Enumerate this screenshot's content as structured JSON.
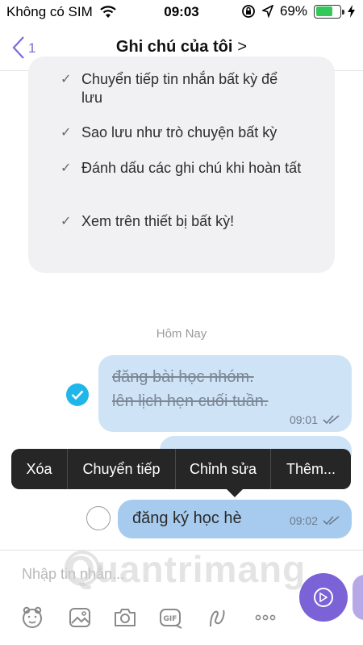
{
  "status_bar": {
    "carrier": "Không có SIM",
    "time": "09:03",
    "battery_text": "69%",
    "battery_level": 0.69
  },
  "nav": {
    "back_count": "1",
    "title": "Ghi chú của tôi",
    "title_chevron": ">"
  },
  "info_card": {
    "items": [
      {
        "tick": "✓",
        "text": "Chuyển tiếp tin nhắn bất kỳ để lưu"
      },
      {
        "tick": "✓",
        "text": "Sao lưu như trò chuyện bất kỳ"
      },
      {
        "tick": "✓",
        "text": "Đánh dấu các ghi chú khi hoàn tất"
      },
      {
        "tick": "✓",
        "text": "Xem trên thiết bị bất kỳ!"
      }
    ]
  },
  "date_separator": "Hôm Nay",
  "messages": [
    {
      "line1": "đăng bài học nhóm.",
      "line2": "lên lịch hẹn cuối tuần.",
      "time": "09:01",
      "state": "done"
    },
    {
      "text": "đăng ký học hè",
      "time": "09:02",
      "state": "open"
    }
  ],
  "context_menu": {
    "items": [
      "Xóa",
      "Chuyển tiếp",
      "Chỉnh sửa",
      "Thêm..."
    ]
  },
  "input": {
    "placeholder": "Nhập tin nhắn..."
  },
  "watermark": "Quantrimang",
  "colors": {
    "accent": "#7b62d6",
    "bubble": "#cfe3f7",
    "bubble_selected": "#a7cbef",
    "check": "#1fb6ea",
    "menu_bg": "#262626"
  },
  "toolbar_icons": [
    "sticker-icon",
    "gallery-icon",
    "camera-icon",
    "gif-icon",
    "doodle-icon",
    "more-icon"
  ]
}
